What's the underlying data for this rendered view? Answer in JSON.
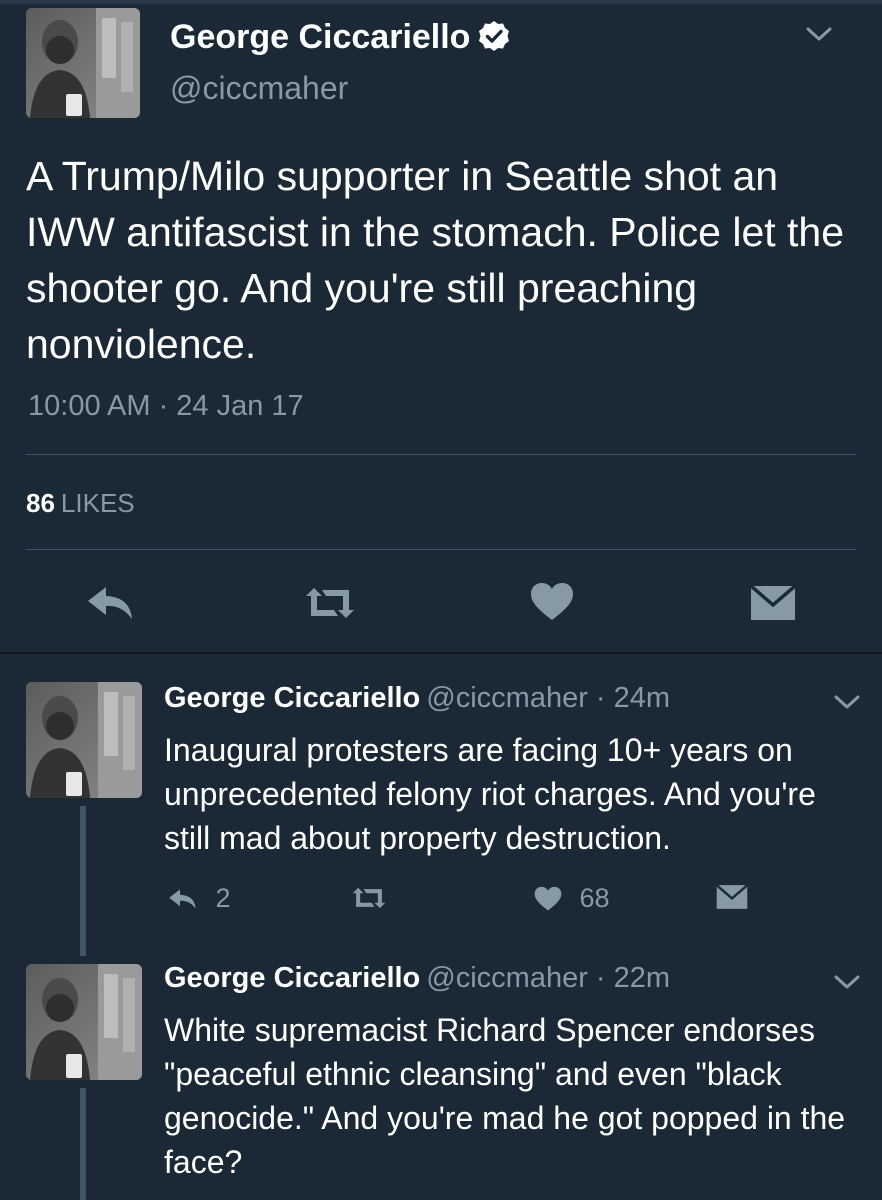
{
  "main_tweet": {
    "author_name": "George Ciccariello",
    "handle": "@ciccmaher",
    "text": "A Trump/Milo supporter in Seattle shot an IWW antifascist in the stomach. Police let the shooter go. And you're still preaching nonviolence.",
    "timestamp": "10:00 AM · 24 Jan 17",
    "likes_count": "86",
    "likes_label": "LIKES"
  },
  "thread": [
    {
      "author_name": "George Ciccariello",
      "handle_time": "@ciccmaher · 24m",
      "text": "Inaugural protesters are facing 10+ years on unprecedented felony riot charges. And you're still mad about property destruction.",
      "reply_count": "2",
      "like_count": "68"
    },
    {
      "author_name": "George Ciccariello",
      "handle_time": "@ciccmaher · 22m",
      "text": "White supremacist Richard Spencer endorses \"peaceful ethnic cleansing\" and even \"black genocide.\" And you're mad he got popped in the face?"
    }
  ],
  "colors": {
    "background": "#1b2836",
    "text_primary": "#ffffff",
    "text_secondary": "#8899a6",
    "icon": "#8899a6",
    "divider": "#3d5466"
  },
  "icons": [
    "verified-badge-icon",
    "chevron-down-icon",
    "reply-icon",
    "retweet-icon",
    "heart-icon",
    "direct-message-icon"
  ]
}
